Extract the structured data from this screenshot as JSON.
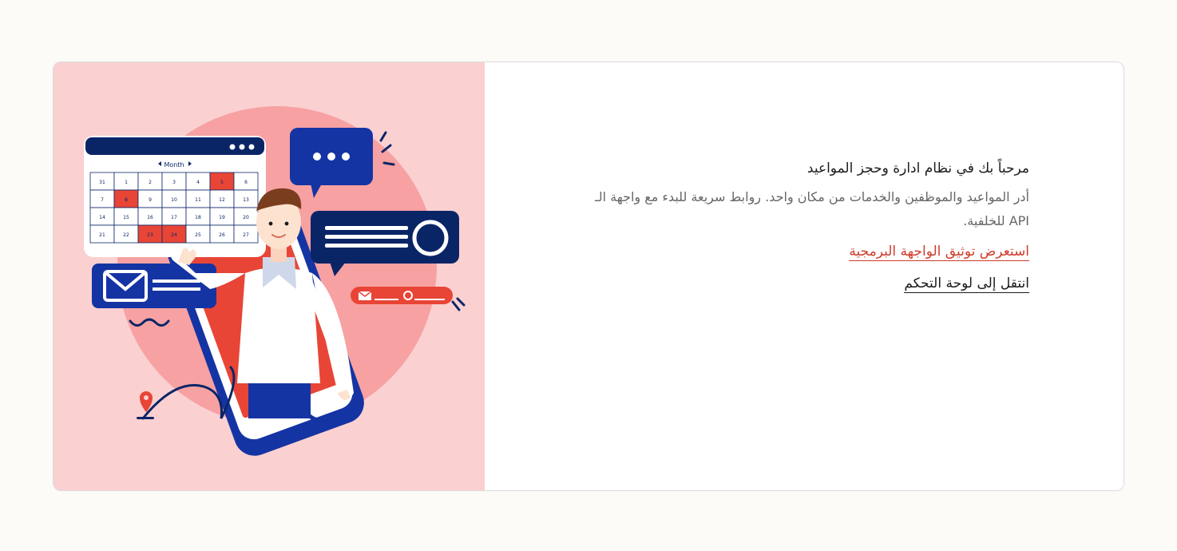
{
  "illustration": {
    "calendar_header": "Month",
    "calendar_days": [
      "31",
      "1",
      "2",
      "3",
      "4",
      "5",
      "6",
      "7",
      "8",
      "9",
      "10",
      "11",
      "12",
      "13",
      "14",
      "15",
      "16",
      "17",
      "18",
      "19",
      "20",
      "21",
      "22",
      "23",
      "24",
      "25",
      "26",
      "27"
    ]
  },
  "welcome": {
    "title": "مرحباً بك في نظام ادارة وحجز المواعيد",
    "description": "أدر المواعيد والموظفين والخدمات من مكان واحد. روابط سريعة للبدء مع واجهة الـ API للخلفية.",
    "api_docs_link": "استعرض توثيق الواجهة البرمجية",
    "dashboard_link": "انتقل إلى لوحة التحكم"
  },
  "colors": {
    "illustration_bg": "#fad0d1",
    "accent_red": "#cf3b2b",
    "navy": "#0a2566",
    "blue": "#1534a3"
  }
}
